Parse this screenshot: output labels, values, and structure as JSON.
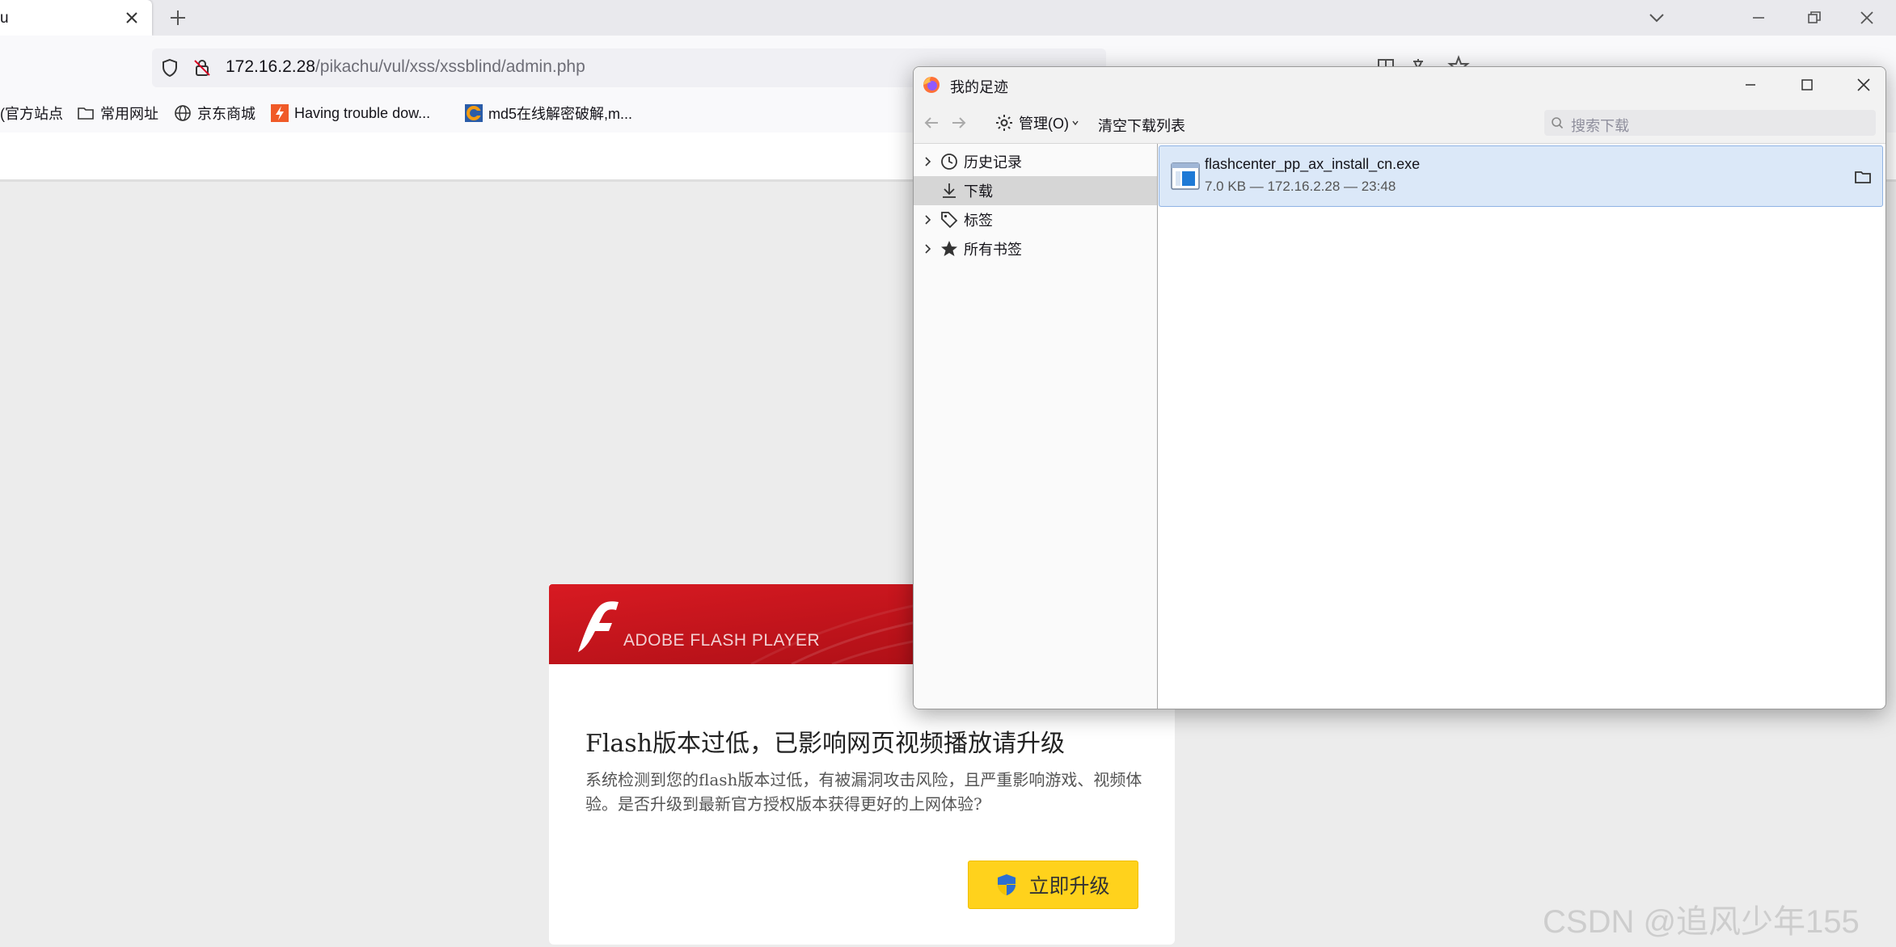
{
  "browser": {
    "tab": {
      "title": "u"
    },
    "url": {
      "host": "172.16.2.28",
      "path": "/pikachu/vul/xss/xssblind/admin.php"
    },
    "url_icons": [
      "reader-icon",
      "translate-icon",
      "star-icon"
    ],
    "bookmarks": [
      {
        "label": "(官方站点",
        "icon": "none"
      },
      {
        "label": "常用网址",
        "icon": "folder-icon"
      },
      {
        "label": "京东商城",
        "icon": "globe-icon"
      },
      {
        "label": "Having trouble dow...",
        "icon": "orange-bolt-icon"
      },
      {
        "label": "md5在线解密破解,m...",
        "icon": "cmd5-icon"
      }
    ]
  },
  "flash": {
    "banner_text": "ADOBE FLASH PLAYER",
    "title": "Flash版本过低，已影响网页视频播放请升级",
    "description": "系统检测到您的flash版本过低，有被漏洞攻击风险，且严重影响游戏、视频体验。是否升级到最新官方授权版本获得更好的上网体验?",
    "button_label": "立即升级",
    "colors": {
      "banner": "#c8141e",
      "button": "#ffd21c"
    }
  },
  "library": {
    "title": "我的足迹",
    "toolbar": {
      "manage_label": "管理(O)",
      "clear_label": "清空下载列表",
      "search_placeholder": "搜索下载"
    },
    "sidebar": [
      {
        "label": "历史记录",
        "icon": "clock-icon",
        "expandable": true,
        "selected": false
      },
      {
        "label": "下载",
        "icon": "download-icon",
        "expandable": false,
        "selected": true
      },
      {
        "label": "标签",
        "icon": "tag-icon",
        "expandable": true,
        "selected": false
      },
      {
        "label": "所有书签",
        "icon": "star-icon",
        "expandable": true,
        "selected": false
      }
    ],
    "downloads": [
      {
        "filename": "flashcenter_pp_ax_install_cn.exe",
        "details": "7.0 KB — 172.16.2.28 — 23:48"
      }
    ]
  },
  "watermark": "CSDN @追风少年155"
}
